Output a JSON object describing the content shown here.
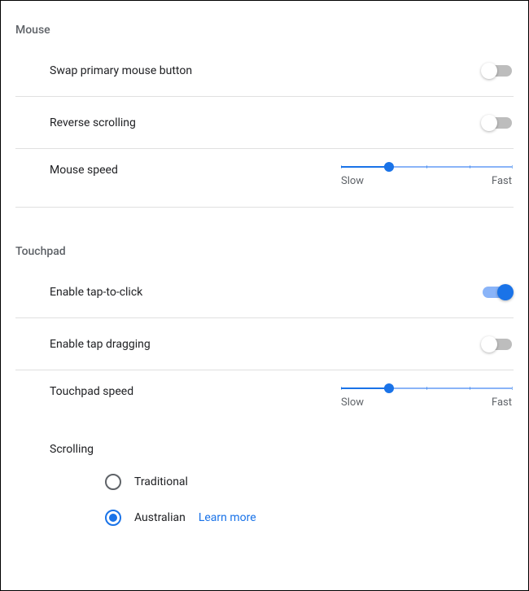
{
  "mouse": {
    "title": "Mouse",
    "swap_label": "Swap primary mouse button",
    "swap_on": false,
    "reverse_label": "Reverse scrolling",
    "reverse_on": false,
    "speed_label": "Mouse speed",
    "speed_percent": 28,
    "slow_label": "Slow",
    "fast_label": "Fast"
  },
  "touchpad": {
    "title": "Touchpad",
    "tap_click_label": "Enable tap-to-click",
    "tap_click_on": true,
    "tap_drag_label": "Enable tap dragging",
    "tap_drag_on": false,
    "speed_label": "Touchpad speed",
    "speed_percent": 28,
    "slow_label": "Slow",
    "fast_label": "Fast",
    "scrolling_label": "Scrolling",
    "option_traditional": "Traditional",
    "option_australian": "Australian",
    "selected": "australian",
    "learn_more": "Learn more"
  }
}
